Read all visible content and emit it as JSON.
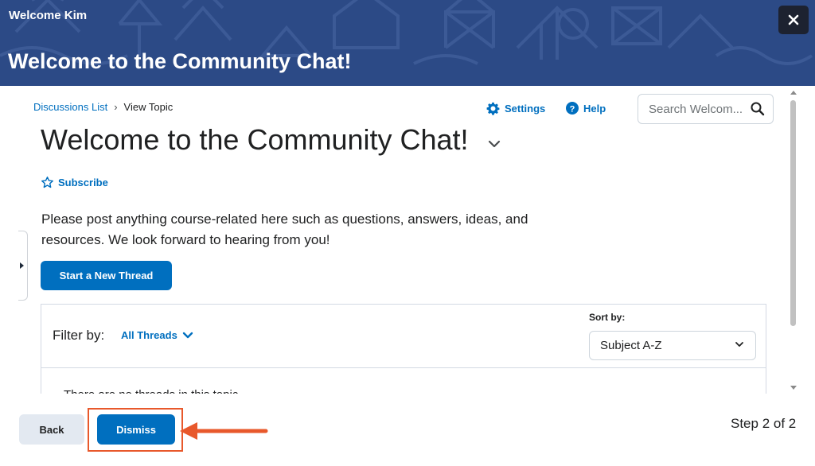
{
  "banner": {
    "welcome": "Welcome Kim",
    "title": "Welcome to the Community Chat!",
    "close_icon": "close-icon"
  },
  "breadcrumb": {
    "items": [
      "Discussions List",
      "View Topic"
    ],
    "separator": "›"
  },
  "toolbar": {
    "settings_label": "Settings",
    "help_label": "Help"
  },
  "search": {
    "placeholder": "Search Welcom..."
  },
  "topic": {
    "title": "Welcome to the Community Chat!",
    "subscribe_label": "Subscribe",
    "description": "Please post anything course-related here such as questions, answers, ideas, and resources. We look forward to hearing from you!",
    "start_thread_label": "Start a New Thread"
  },
  "filter": {
    "label": "Filter by:",
    "value": "All Threads",
    "sort_label": "Sort by:",
    "sort_value": "Subject A-Z",
    "empty_message": "There are no threads in this topic."
  },
  "footer": {
    "back_label": "Back",
    "dismiss_label": "Dismiss",
    "step_text": "Step 2 of 2"
  },
  "colors": {
    "banner": "#2c4a86",
    "accent": "#006fbf",
    "highlight": "#e8582b"
  }
}
